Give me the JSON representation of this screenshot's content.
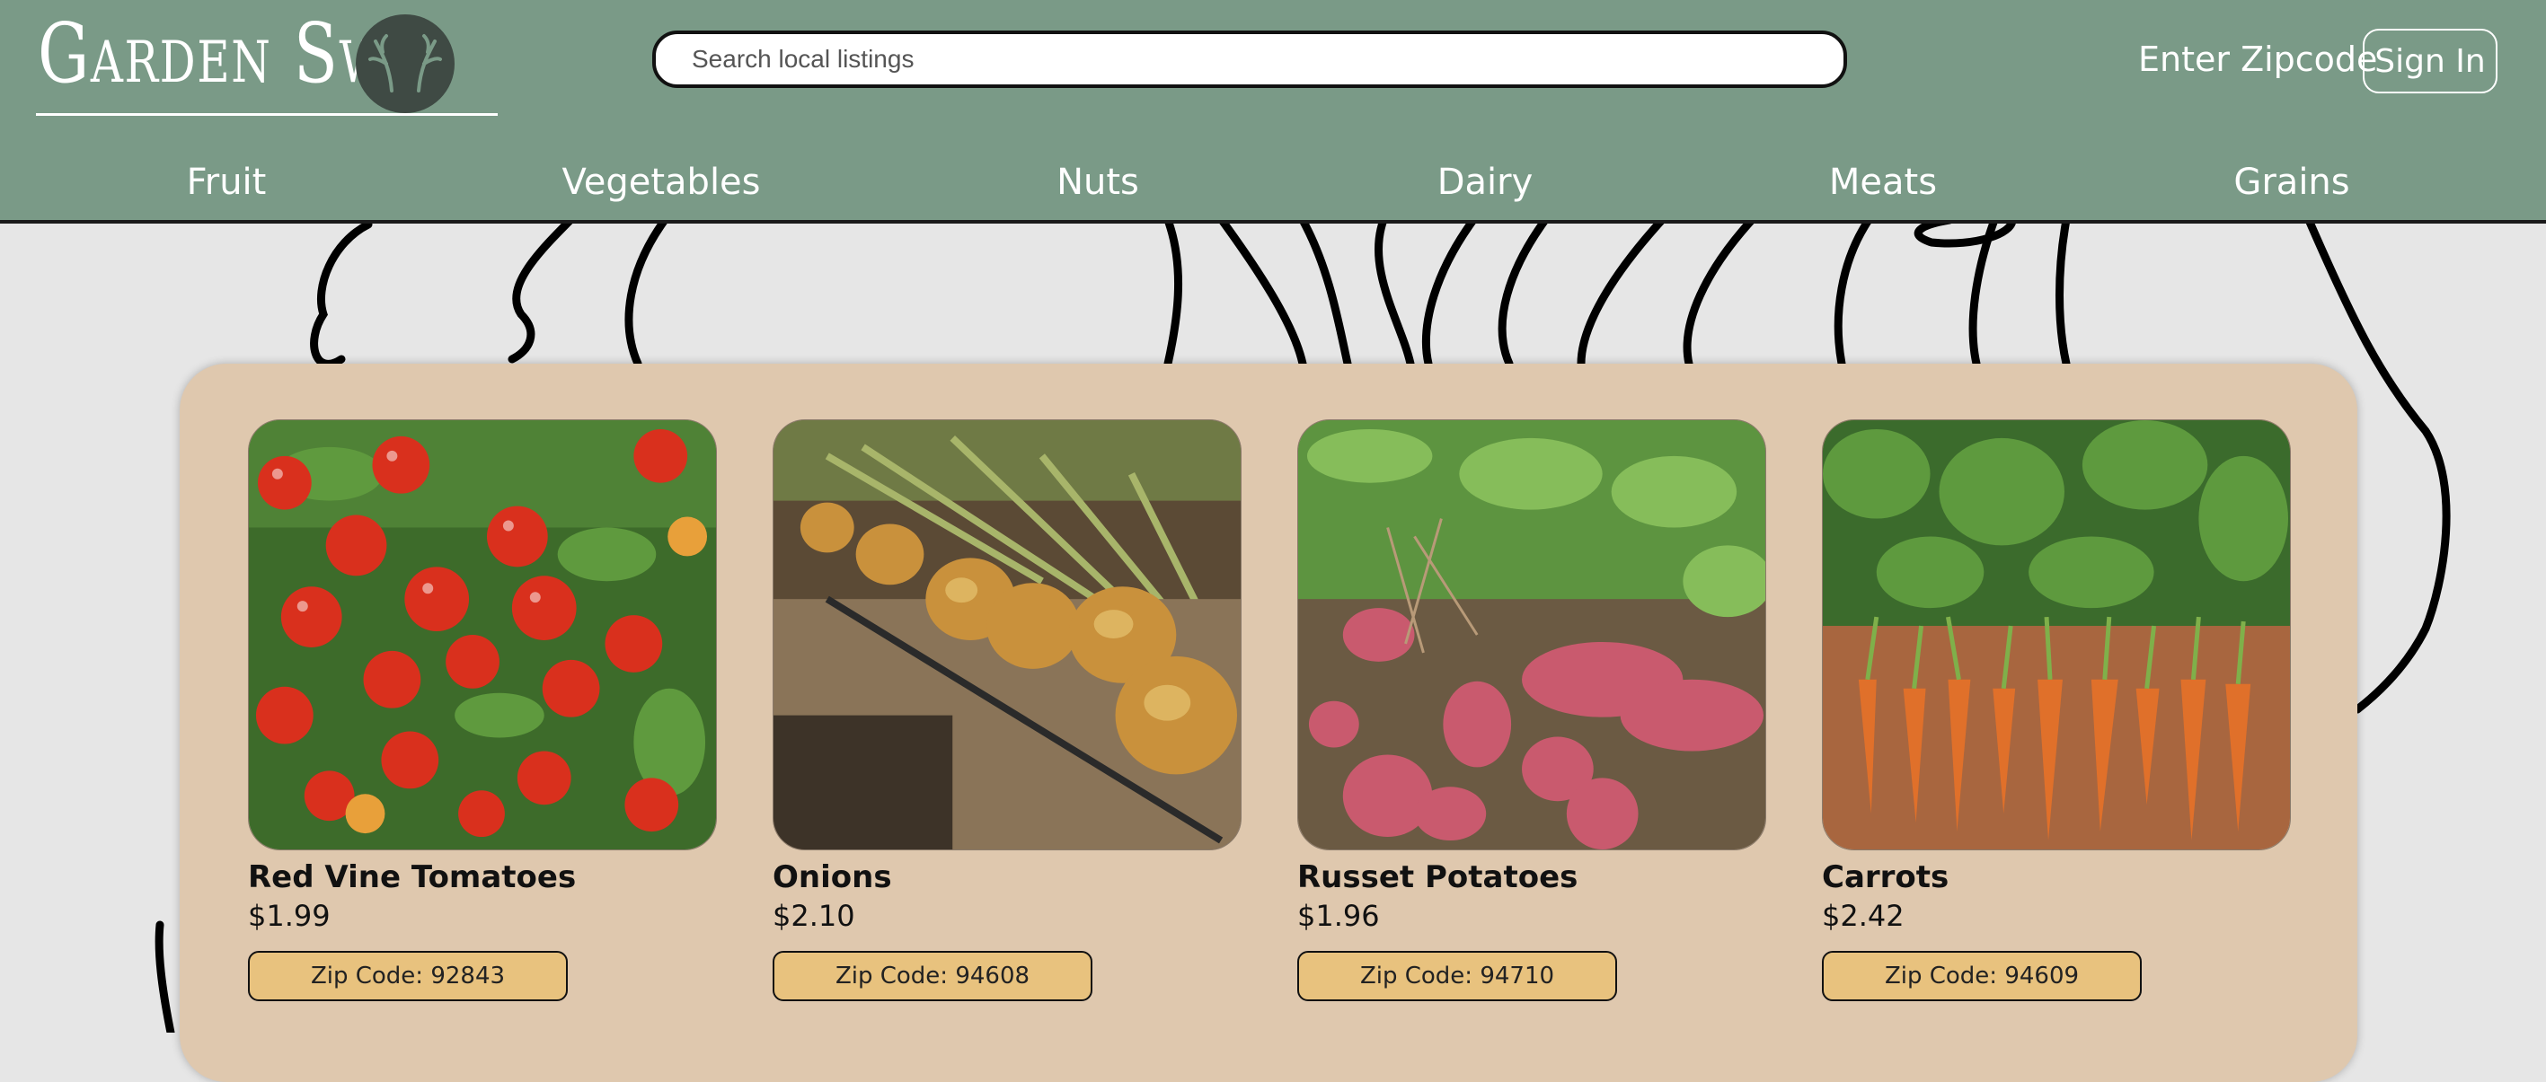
{
  "header": {
    "logo_text": "Garden Swap",
    "search": {
      "placeholder": "Search local listings"
    },
    "zipcode_label": "Enter Zipcode",
    "signin_label": "Sign In"
  },
  "nav": [
    {
      "label": "Fruit"
    },
    {
      "label": "Vegetables"
    },
    {
      "label": "Nuts"
    },
    {
      "label": "Dairy"
    },
    {
      "label": "Meats"
    },
    {
      "label": "Grains"
    }
  ],
  "listings": [
    {
      "name": "Red Vine Tomatoes",
      "price": "$1.99",
      "zip": "Zip Code: 92843",
      "image": "tomatoes-photo"
    },
    {
      "name": "Onions",
      "price": "$2.10",
      "zip": "Zip Code: 94608",
      "image": "onions-photo"
    },
    {
      "name": "Russet Potatoes",
      "price": "$1.96",
      "zip": "Zip Code: 94710",
      "image": "potatoes-photo"
    },
    {
      "name": "Carrots",
      "price": "$2.42",
      "zip": "Zip Code: 94609",
      "image": "carrots-photo"
    }
  ],
  "colors": {
    "header_bg": "#7a9a87",
    "panel_bg": "#dfc8ae",
    "zip_button_bg": "#e8c27e",
    "page_bg": "#e6e6e6"
  }
}
